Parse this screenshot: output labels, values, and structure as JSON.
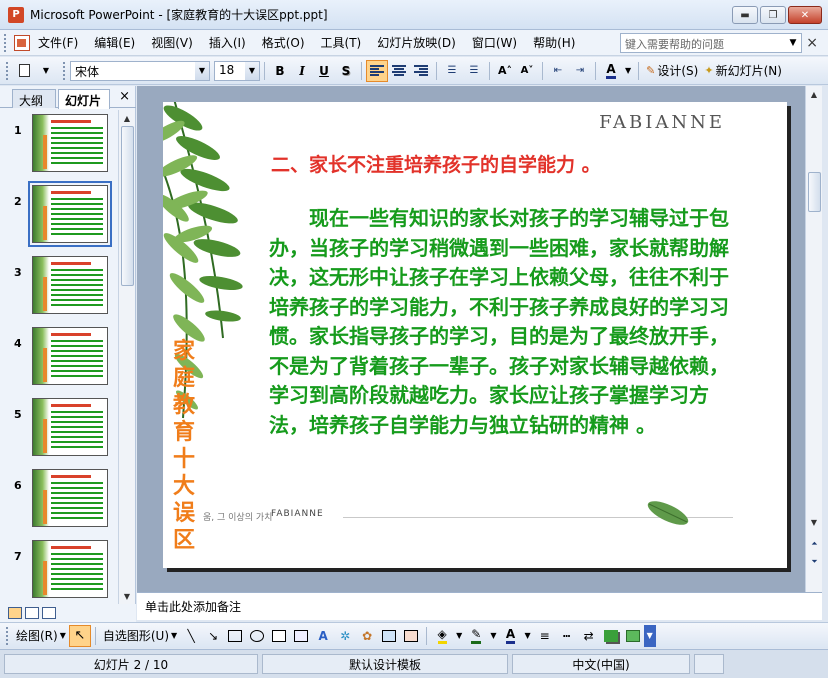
{
  "window": {
    "title": "Microsoft PowerPoint - [家庭教育的十大误区ppt.ppt]",
    "minimize": "▬",
    "restore": "❐",
    "close": "✕"
  },
  "menu": {
    "items": [
      "文件(F)",
      "编辑(E)",
      "视图(V)",
      "插入(I)",
      "格式(O)",
      "工具(T)",
      "幻灯片放映(D)",
      "窗口(W)",
      "帮助(H)"
    ],
    "help_placeholder": "键入需要帮助的问题",
    "close": "×"
  },
  "toolbar": {
    "font": "宋体",
    "size": "18",
    "bold": "B",
    "italic": "I",
    "underline": "U",
    "shadow": "S",
    "grow_font": "A˄",
    "shrink_font": "A˅",
    "font_color": "A",
    "design": "设计(S)",
    "new_slide": "新幻灯片(N)"
  },
  "left_panel": {
    "tab_outline": "大纲",
    "tab_slides": "幻灯片",
    "close": "×",
    "slide_numbers": [
      "1",
      "2",
      "3",
      "4",
      "5",
      "6",
      "7"
    ]
  },
  "slide": {
    "brand": "FABIANNE",
    "title": "二、家长不注重培养孩子的自学能力 。",
    "body": "现在一些有知识的家长对孩子的学习辅导过于包办，当孩子的学习稍微遇到一些困难，家长就帮助解决，这无形中让孩子在学习上依赖父母，往往不利于培养孩子的学习能力，不利于孩子养成良好的学习习惯。家长指导孩子的学习，目的是为了最终放开手，不是为了背着孩子一辈子。孩子对家长辅导越依赖，学习到高阶段就越吃力。家长应让孩子掌握学习方法，培养孩子自学能力与独立钻研的精神 。",
    "vertical_title": "家庭教育十大误区",
    "footer_text": "움, 그 이상의 가치",
    "footer_brand": "FABIANNE"
  },
  "notes": {
    "placeholder": "单击此处添加备注"
  },
  "drawbar": {
    "draw": "绘图(R)",
    "autoshapes": "自选图形(U)"
  },
  "status": {
    "slide_info": "幻灯片 2 / 10",
    "template": "默认设计模板",
    "language": "中文(中国)"
  },
  "colors": {
    "title_red": "#e2322a",
    "body_green": "#169b1c",
    "vertical_orange": "#f07d1a"
  }
}
